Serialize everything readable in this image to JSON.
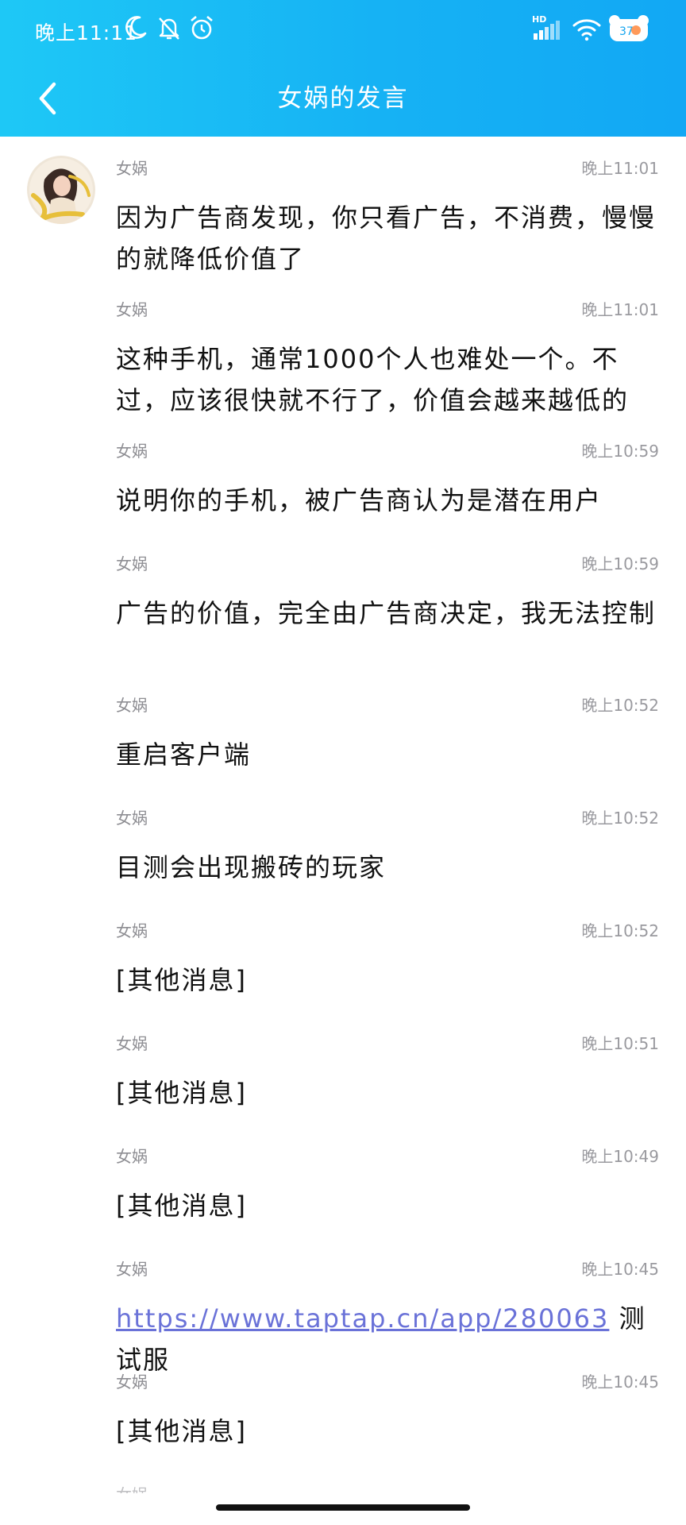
{
  "status_bar": {
    "time": "晚上11:11",
    "network_label": "HD",
    "battery_level": "37"
  },
  "nav": {
    "title": "女娲的发言"
  },
  "messages": [
    {
      "sender": "女娲",
      "time": "晚上11:01",
      "text": "因为广告商发现，你只看广告，不消费，慢慢的就降低价值了"
    },
    {
      "sender": "女娲",
      "time": "晚上11:01",
      "text": "这种手机，通常1000个人也难处一个。不过，应该很快就不行了，价值会越来越低的"
    },
    {
      "sender": "女娲",
      "time": "晚上10:59",
      "text": "说明你的手机，被广告商认为是潜在用户"
    },
    {
      "sender": "女娲",
      "time": "晚上10:59",
      "text": "广告的价值，完全由广告商决定，我无法控制"
    },
    {
      "sender": "女娲",
      "time": "晚上10:52",
      "text": "重启客户端"
    },
    {
      "sender": "女娲",
      "time": "晚上10:52",
      "text": "目测会出现搬砖的玩家"
    },
    {
      "sender": "女娲",
      "time": "晚上10:52",
      "text": "[其他消息]"
    },
    {
      "sender": "女娲",
      "time": "晚上10:51",
      "text": "[其他消息]"
    },
    {
      "sender": "女娲",
      "time": "晚上10:49",
      "text": "[其他消息]"
    },
    {
      "sender": "女娲",
      "time": "晚上10:45",
      "link": "https://www.taptap.cn/app/280063",
      "text_after": " 测试服"
    },
    {
      "sender": "女娲",
      "time": "晚上10:45",
      "text": "[其他消息]"
    }
  ]
}
